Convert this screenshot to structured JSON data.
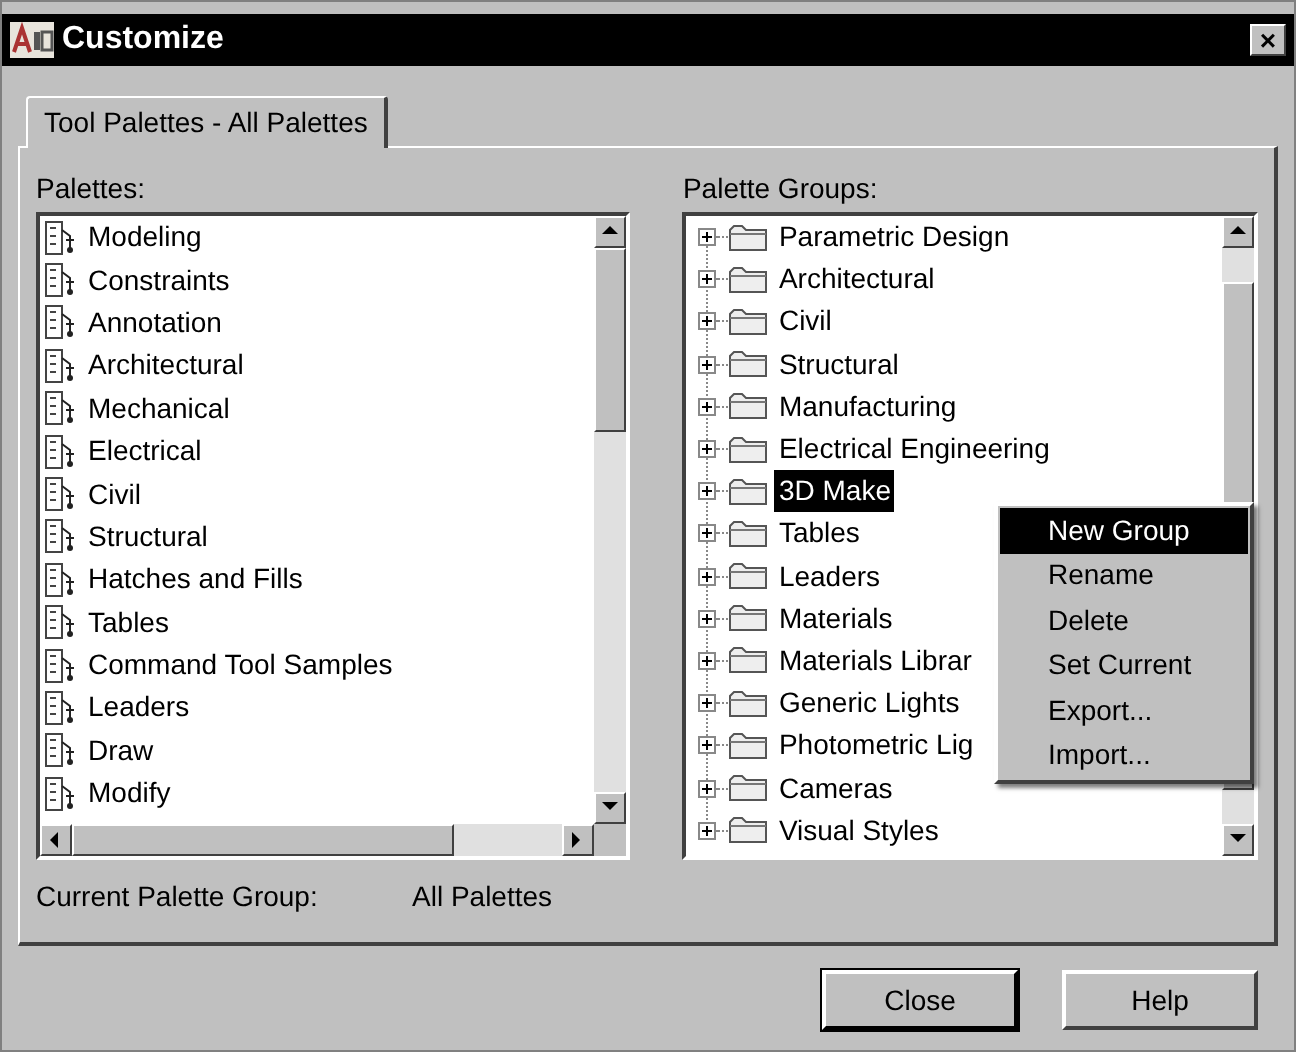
{
  "window": {
    "title": "Customize",
    "close": "×"
  },
  "tabs": [
    {
      "label": "Tool Palettes - All Palettes",
      "selected": true
    }
  ],
  "palettes": {
    "label": "Palettes:",
    "items": [
      {
        "label": "Modeling"
      },
      {
        "label": "Constraints"
      },
      {
        "label": "Annotation"
      },
      {
        "label": "Architectural"
      },
      {
        "label": "Mechanical"
      },
      {
        "label": "Electrical"
      },
      {
        "label": "Civil"
      },
      {
        "label": "Structural"
      },
      {
        "label": "Hatches and Fills"
      },
      {
        "label": "Tables"
      },
      {
        "label": "Command Tool Samples"
      },
      {
        "label": "Leaders"
      },
      {
        "label": "Draw"
      },
      {
        "label": "Modify"
      }
    ]
  },
  "palette_groups": {
    "label": "Palette Groups:",
    "items": [
      {
        "label": "Parametric Design",
        "expanded": false,
        "selected": false
      },
      {
        "label": "Architectural",
        "expanded": false,
        "selected": false
      },
      {
        "label": "Civil",
        "expanded": false,
        "selected": false
      },
      {
        "label": "Structural",
        "expanded": false,
        "selected": false
      },
      {
        "label": "Manufacturing",
        "expanded": false,
        "selected": false
      },
      {
        "label": "Electrical Engineering",
        "expanded": false,
        "selected": false
      },
      {
        "label": "3D Make",
        "expanded": false,
        "selected": true
      },
      {
        "label": "Tables",
        "expanded": false,
        "selected": false
      },
      {
        "label": "Leaders",
        "expanded": false,
        "selected": false
      },
      {
        "label": "Materials",
        "expanded": false,
        "selected": false
      },
      {
        "label": "Materials Librar",
        "expanded": false,
        "selected": false
      },
      {
        "label": "Generic Lights",
        "expanded": false,
        "selected": false
      },
      {
        "label": "Photometric Lig",
        "expanded": false,
        "selected": false
      },
      {
        "label": "Cameras",
        "expanded": false,
        "selected": false
      },
      {
        "label": "Visual Styles",
        "expanded": false,
        "selected": false
      }
    ]
  },
  "context_menu": [
    {
      "label": "New Group",
      "selected": true
    },
    {
      "label": "Rename",
      "selected": false
    },
    {
      "label": "Delete",
      "selected": false
    },
    {
      "label": "Set Current",
      "selected": false
    },
    {
      "label": "Export...",
      "selected": false
    },
    {
      "label": "Import...",
      "selected": false
    }
  ],
  "current_group": {
    "label": "Current Palette Group:",
    "value": "All Palettes"
  },
  "buttons": [
    "Close",
    "Help"
  ]
}
